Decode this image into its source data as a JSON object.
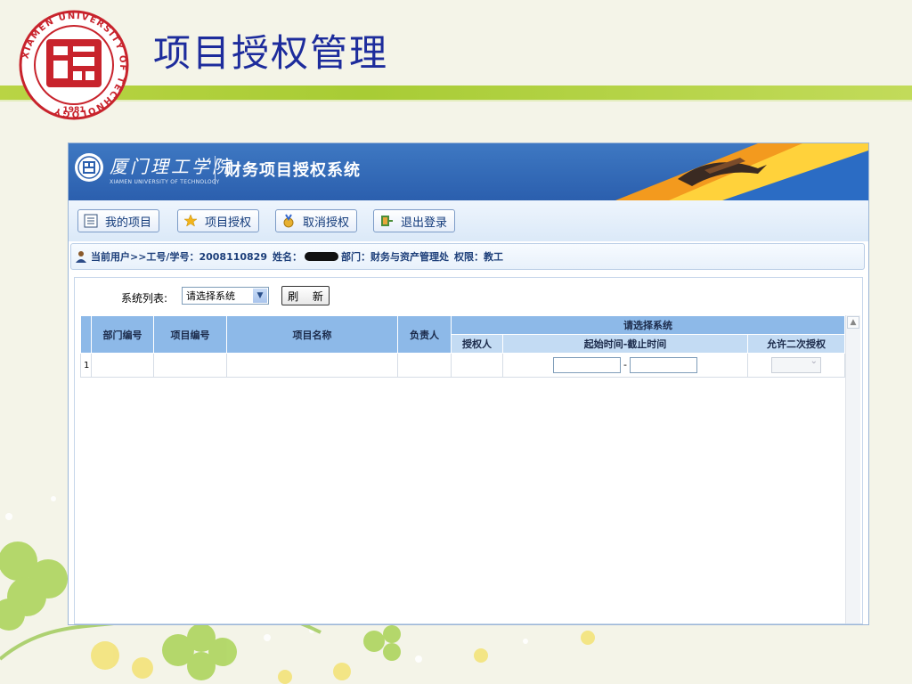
{
  "slide": {
    "title": "项目授权管理",
    "logo_text": "XIAMEN UNIVERSITY OF TECHNOLOGY",
    "logo_year": "1981"
  },
  "app": {
    "school_name": "厦门理工学院",
    "school_name_en": "XIAMEN UNIVERSITY OF TECHNOLOGY",
    "system_title": "财务项目授权系统",
    "toolbar": {
      "my_projects": "我的项目",
      "project_authorize": "项目授权",
      "cancel_authorize": "取消授权",
      "logout": "退出登录"
    },
    "userbar": {
      "current_user": "当前用户>>工号/学号：2008110829",
      "name_label": "姓名：",
      "dept": "部门：财务与资产管理处",
      "role": "权限：教工"
    },
    "filter": {
      "label": "系统列表:",
      "selected": "请选择系统",
      "refresh": "刷 新"
    },
    "grid": {
      "headers": {
        "dept_no": "部门编号",
        "project_no": "项目编号",
        "project_name": "项目名称",
        "owner": "负责人",
        "group": "请选择系统",
        "grantee": "授权人",
        "period": "起始时间-截止时间",
        "allow_secondary": "允许二次授权"
      },
      "rows": [
        {
          "num": "1",
          "date_sep": "-"
        }
      ]
    }
  },
  "colors": {
    "title": "#1d2c9c",
    "band": "#a8cc35",
    "header_blue": "#2b5fae",
    "grid_header": "#8db9e8"
  }
}
